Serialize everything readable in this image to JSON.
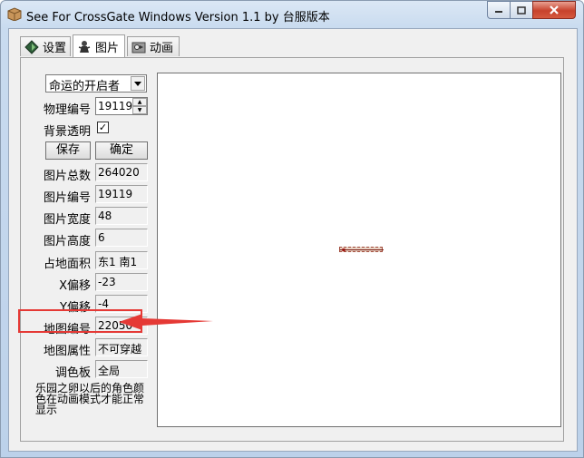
{
  "window": {
    "title": "See For CrossGate Windows Version 1.1 by 台服版本",
    "controls": {
      "minimize": "minimize-icon",
      "maximize": "maximize-icon",
      "close": "close-icon"
    }
  },
  "tabs": [
    {
      "label": "设置",
      "icon": "settings-diamond-icon"
    },
    {
      "label": "图片",
      "icon": "character-icon"
    },
    {
      "label": "动画",
      "icon": "animation-icon"
    }
  ],
  "active_tab": "图片",
  "form": {
    "category_select": "命运的开启者",
    "physical_id": {
      "label": "物理编号",
      "value": "19119"
    },
    "bg_transparent": {
      "label": "背景透明",
      "checked": "✓"
    },
    "save_label": "保存",
    "confirm_label": "确定",
    "total_images": {
      "label": "图片总数",
      "value": "264020"
    },
    "image_id": {
      "label": "图片编号",
      "value": "19119"
    },
    "image_width": {
      "label": "图片宽度",
      "value": "48"
    },
    "image_height": {
      "label": "图片高度",
      "value": "6"
    },
    "footprint": {
      "label": "占地面积",
      "value": "东1 南1"
    },
    "x_offset": {
      "label": "X偏移",
      "value": "-23"
    },
    "y_offset": {
      "label": "Y偏移",
      "value": "-4"
    },
    "map_id": {
      "label": "地图编号",
      "value": "22050"
    },
    "map_attr": {
      "label": "地图属性",
      "value": "不可穿越"
    },
    "palette": {
      "label": "调色板",
      "value": "全局"
    },
    "note": "乐园之卵以后的角色颜色在动画模式才能正常显示"
  },
  "annotation": {
    "color": "#e53935"
  }
}
